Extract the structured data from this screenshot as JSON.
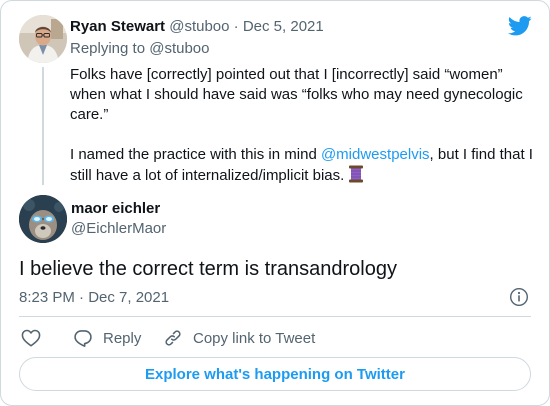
{
  "parent_tweet": {
    "author_name": "Ryan Stewart",
    "author_handle": "@stuboo",
    "separator": "·",
    "date": "Dec 5, 2021",
    "replying_prefix": "Replying to",
    "replying_to": "@stuboo",
    "paragraph1": "Folks have [correctly] pointed out that I [incorrectly] said “women” when what I should have said was “folks who may need gynecologic care.”",
    "paragraph2_before": "I named the practice with this in mind ",
    "paragraph2_mention": "@midwestpelvis",
    "paragraph2_after": ", but I find that I still have a lot of internalized/implicit bias. ",
    "emoji_icon": "thread-spool-icon"
  },
  "main_tweet": {
    "author_name": "maor eichler",
    "author_handle": "@EichlerMaor",
    "text": "I believe the correct term is transandrology",
    "timestamp": "8:23 PM · Dec 7, 2021"
  },
  "actions": {
    "like_icon": "heart-icon",
    "reply_label": "Reply",
    "copy_label": "Copy link to Tweet"
  },
  "explore_label": "Explore what's happening on Twitter",
  "colors": {
    "twitter_blue": "#1d9bf0",
    "text_primary": "#0f1419",
    "text_secondary": "#536471",
    "border": "#cfd9de"
  }
}
